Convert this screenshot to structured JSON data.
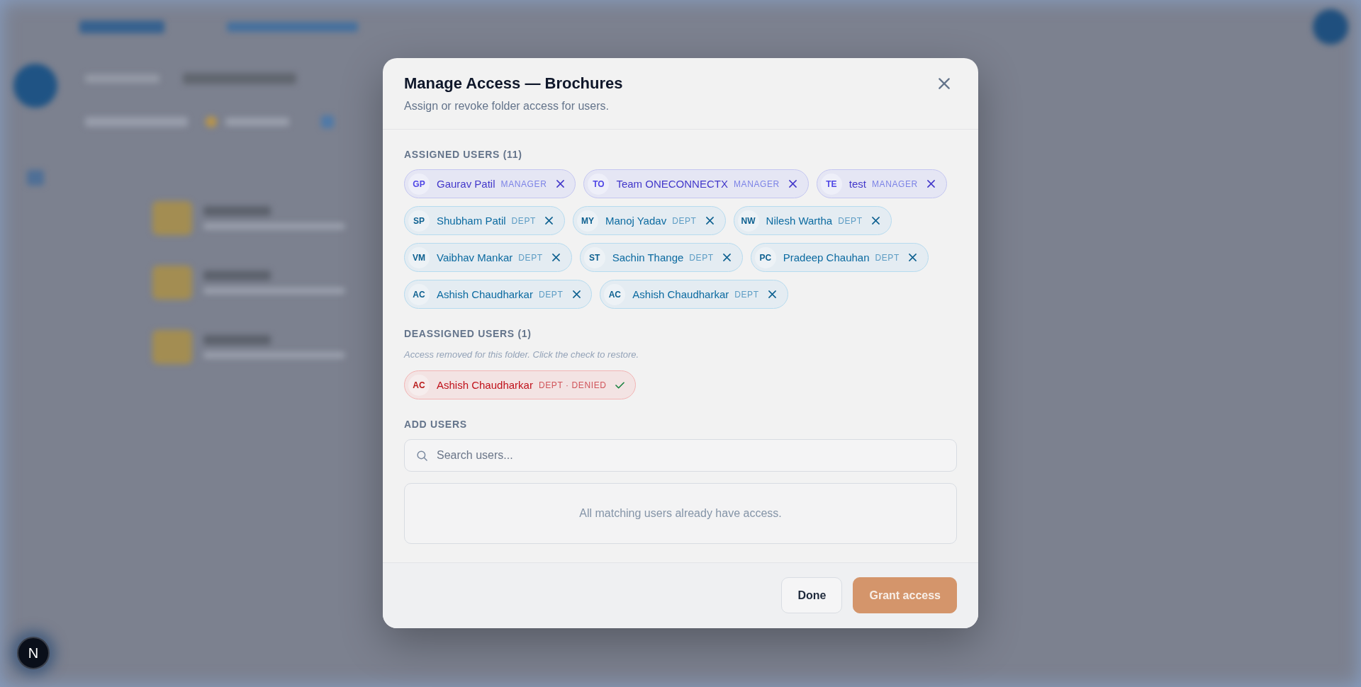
{
  "dialog": {
    "title": "Manage Access — Brochures",
    "subtitle": "Assign or revoke folder access for users."
  },
  "assigned_users": {
    "heading": "ASSIGNED USERS (11)",
    "users": [
      {
        "initials": "GP",
        "name": "Gaurav Patil",
        "role": "MANAGER",
        "kind": "manager"
      },
      {
        "initials": "TO",
        "name": "Team ONECONNECTX",
        "role": "MANAGER",
        "kind": "manager"
      },
      {
        "initials": "TE",
        "name": "test",
        "role": "MANAGER",
        "kind": "manager"
      },
      {
        "initials": "SP",
        "name": "Shubham Patil",
        "role": "DEPT",
        "kind": "dept"
      },
      {
        "initials": "MY",
        "name": "Manoj Yadav",
        "role": "DEPT",
        "kind": "dept"
      },
      {
        "initials": "NW",
        "name": "Nilesh Wartha",
        "role": "DEPT",
        "kind": "dept"
      },
      {
        "initials": "VM",
        "name": "Vaibhav Mankar",
        "role": "DEPT",
        "kind": "dept"
      },
      {
        "initials": "ST",
        "name": "Sachin Thange",
        "role": "DEPT",
        "kind": "dept"
      },
      {
        "initials": "PC",
        "name": "Pradeep Chauhan",
        "role": "DEPT",
        "kind": "dept"
      },
      {
        "initials": "AC",
        "name": "Ashish Chaudharkar",
        "role": "DEPT",
        "kind": "dept"
      },
      {
        "initials": "AC",
        "name": "Ashish Chaudharkar",
        "role": "DEPT",
        "kind": "dept"
      }
    ]
  },
  "deassigned_users": {
    "heading": "DEASSIGNED USERS (1)",
    "note": "Access removed for this folder. Click the check to restore.",
    "users": [
      {
        "initials": "AC",
        "name": "Ashish Chaudharkar",
        "role": "DEPT · DENIED",
        "kind": "denied"
      }
    ]
  },
  "add_users": {
    "heading": "ADD USERS",
    "search": {
      "placeholder": "Search users..."
    },
    "empty_message": "All matching users already have access."
  },
  "footer": {
    "buttons": [
      {
        "label": "Done",
        "kind": "secondary",
        "disabled": false
      },
      {
        "label": "Grant access",
        "kind": "primary",
        "disabled": true
      }
    ]
  },
  "dev_indicator": {
    "label": "N"
  }
}
